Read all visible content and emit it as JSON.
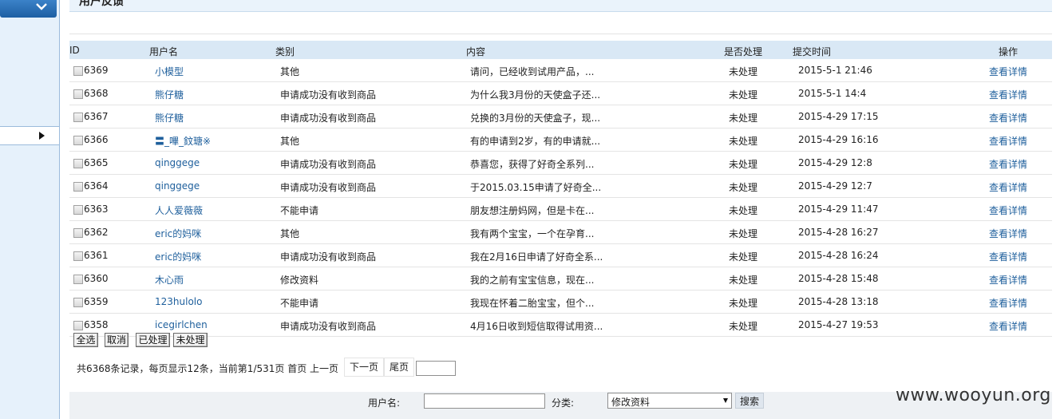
{
  "page_title": "用户反馈",
  "table": {
    "headers": {
      "id": "ID",
      "user": "用户名",
      "category": "类别",
      "content": "内容",
      "status": "是否处理",
      "time": "提交时间",
      "op": "操作"
    },
    "rows": [
      {
        "id": "6369",
        "user": "小模型",
        "category": "其他",
        "content": "请问，已经收到试用产品，...",
        "status": "未处理",
        "time": "2015-5-1 21:46",
        "op": "查看详情"
      },
      {
        "id": "6368",
        "user": "熊仔糖",
        "category": "申请成功没有收到商品",
        "content": "为什么我3月份的天使盒子还...",
        "status": "未处理",
        "time": "2015-5-1 14:4",
        "op": "查看详情"
      },
      {
        "id": "6367",
        "user": "熊仔糖",
        "category": "申请成功没有收到商品",
        "content": "兑换的3月份的天使盒子，现...",
        "status": "未处理",
        "time": "2015-4-29 17:15",
        "op": "查看详情"
      },
      {
        "id": "6366",
        "user": "〓_嗶_鈫瑭※",
        "category": "其他",
        "content": "有的申请到2岁，有的申请就...",
        "status": "未处理",
        "time": "2015-4-29 16:16",
        "op": "查看详情"
      },
      {
        "id": "6365",
        "user": "qinggege",
        "category": "申请成功没有收到商品",
        "content": "恭喜您，获得了好奇全系列...",
        "status": "未处理",
        "time": "2015-4-29 12:8",
        "op": "查看详情"
      },
      {
        "id": "6364",
        "user": "qinggege",
        "category": "申请成功没有收到商品",
        "content": "于2015.03.15申请了好奇全...",
        "status": "未处理",
        "time": "2015-4-29 12:7",
        "op": "查看详情"
      },
      {
        "id": "6363",
        "user": "人人爱薇薇",
        "category": "不能申请",
        "content": "朋友想注册妈网，但是卡在...",
        "status": "未处理",
        "time": "2015-4-29 11:47",
        "op": "查看详情"
      },
      {
        "id": "6362",
        "user": "eric的妈咪",
        "category": "其他",
        "content": "我有两个宝宝，一个在孕育...",
        "status": "未处理",
        "time": "2015-4-28 16:27",
        "op": "查看详情"
      },
      {
        "id": "6361",
        "user": "eric的妈咪",
        "category": "申请成功没有收到商品",
        "content": "我在2月16日申请了好奇全系...",
        "status": "未处理",
        "time": "2015-4-28 16:24",
        "op": "查看详情"
      },
      {
        "id": "6360",
        "user": "木心雨",
        "category": "修改资料",
        "content": "我的之前有宝宝信息，现在...",
        "status": "未处理",
        "time": "2015-4-28 15:48",
        "op": "查看详情"
      },
      {
        "id": "6359",
        "user": "123hulolo",
        "category": "不能申请",
        "content": "我现在怀着二胎宝宝，但个...",
        "status": "未处理",
        "time": "2015-4-28 13:18",
        "op": "查看详情"
      },
      {
        "id": "6358",
        "user": "icegirlchen",
        "category": "申请成功没有收到商品",
        "content": "4月16日收到短信取得试用资...",
        "status": "未处理",
        "time": "2015-4-27 19:53",
        "op": "查看详情"
      }
    ]
  },
  "actions": {
    "select_all": "全选",
    "cancel": "取消",
    "processed": "已处理",
    "unprocessed": "未处理"
  },
  "pager": {
    "summary": "共6368条记录，每页显示12条，当前第1/531页 首页 上一页",
    "next": "下一页",
    "last": "尾页",
    "jump_value": ""
  },
  "search": {
    "user_label": "用户名:",
    "user_value": "",
    "category_label": "分类:",
    "category_value": "修改资料",
    "button": "搜索"
  },
  "watermark": "www.wooyun.org",
  "colors": {
    "link": "#1e5f9c",
    "header_bg": "#d9e8f5",
    "sidebar_bg": "#e6f1fb",
    "sidebar_head": "#2a6fb5"
  }
}
